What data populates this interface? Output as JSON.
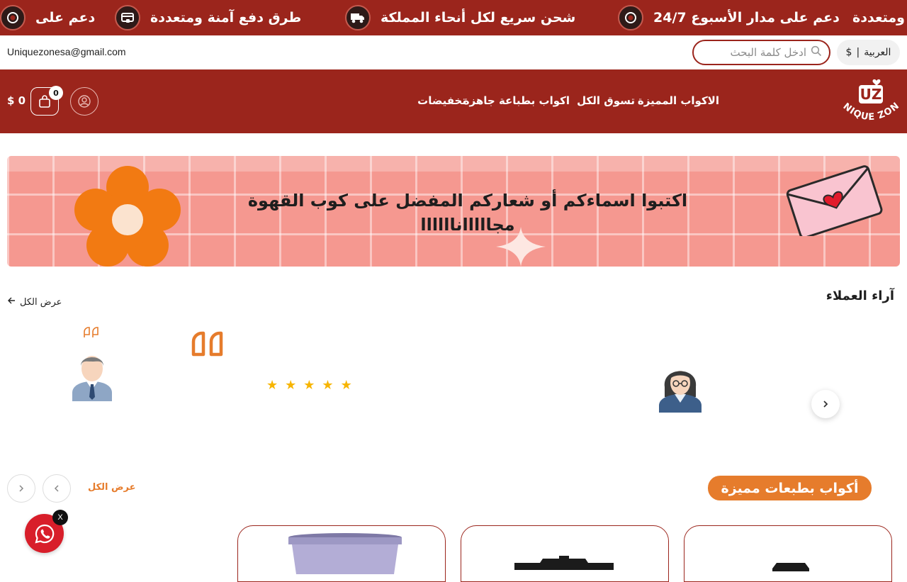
{
  "ticker": {
    "items": [
      {
        "text": "دعم على",
        "icon": "coffee-cup-icon"
      },
      {
        "text": "طرق دفع آمنة ومتعددة",
        "icon": "secure-payment-icon"
      },
      {
        "text": "شحن سريع لكل أنحاء المملكة",
        "icon": "delivery-truck-icon"
      },
      {
        "text": "دعم على مدار الأسبوع 24/7",
        "icon": "coffee-cup-icon"
      },
      {
        "text": "ومتعددة",
        "icon": ""
      }
    ]
  },
  "utility": {
    "email": "Uniquezonesa@gmail.com",
    "search_placeholder": "ادخل كلمة البحث",
    "language": "العربية",
    "currency": "$"
  },
  "header": {
    "logo_text": "UNIQUE ZONE",
    "logo_mark": "UZ",
    "nav": [
      "الاكواب المميزة",
      "تسوق الكل",
      "اكواب بطباعة جاهزة",
      "تخفيضات"
    ],
    "cart_count": "0",
    "cart_total": "$ 0"
  },
  "banner": {
    "line1": "اكتبوا اسماءكم أو شعاركم المفضل على كوب القهوة",
    "line2": "مجاااااناااااا"
  },
  "reviews": {
    "title": "آراء العملاء",
    "view_all": "عرض الكل",
    "rating": 5
  },
  "featured": {
    "title": "أكواب بطبعات مميزة",
    "view_all": "عرض الكل"
  },
  "colors": {
    "brand": "#9b251c",
    "accent": "#e67c2c",
    "star": "#f7b500"
  }
}
